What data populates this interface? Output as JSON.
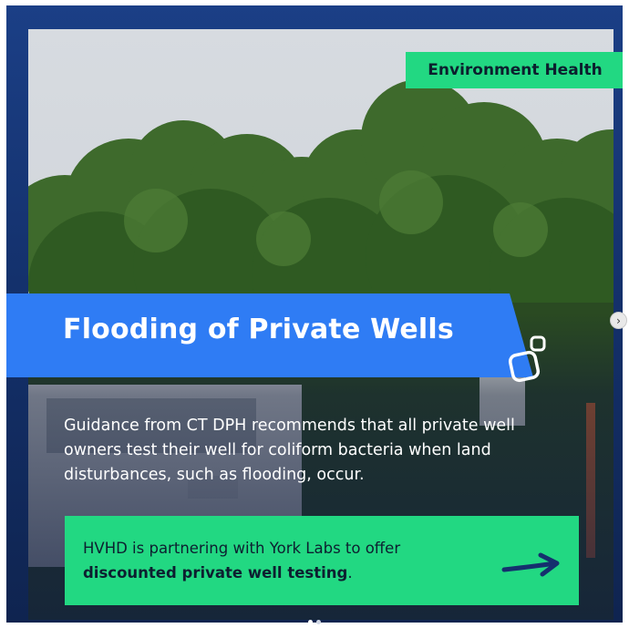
{
  "post": {
    "tag": "Environment Health",
    "title": "Flooding of Private Wells",
    "body": "Guidance from CT DPH recommends that all private well owners test their well for coliform bacteria when land disturbances, such as flooding, occur.",
    "cta_text": "HVHD is partnering with York Labs to offer ",
    "cta_bold": "discounted private well testing",
    "cta_suffix": ".",
    "arrow_icon": "arrow-right-icon"
  },
  "carousel": {
    "next_icon": "chevron-right-icon",
    "next_glyph": "›",
    "slide_count": 2,
    "active_slide": 1
  },
  "colors": {
    "accent_green": "#22d882",
    "title_blue": "#2f7cf4",
    "frame_navy": "#1b3f86"
  }
}
